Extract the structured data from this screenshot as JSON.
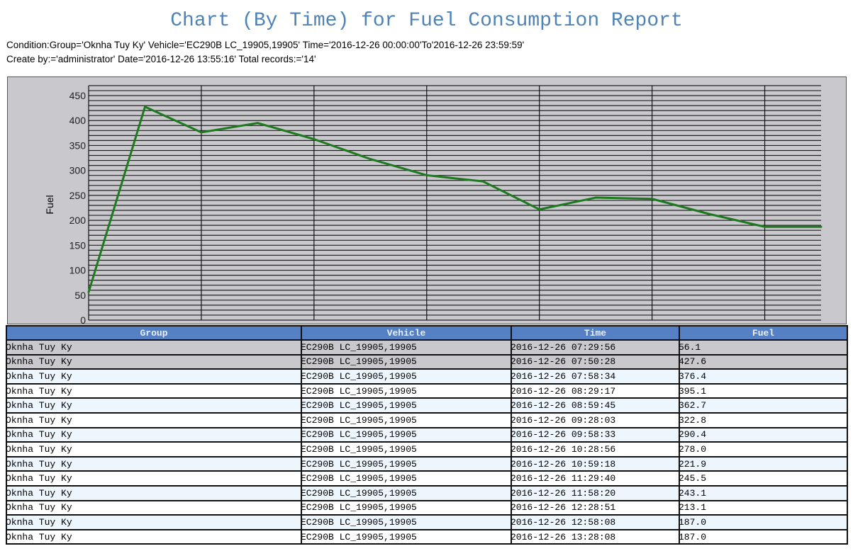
{
  "title": "Chart (By Time) for Fuel Consumption Report",
  "condition_line": "Condition:Group='Oknha Tuy Ky' Vehicle='EC290B LC_19905,19905' Time='2016-12-26 00:00:00'To'2016-12-26 23:59:59'",
  "create_line": "Create by:='administrator' Date='2016-12-26 13:55:16' Total records:='14'",
  "chart_data": {
    "type": "line",
    "ylabel": "Fuel",
    "xlabel": "",
    "ylim": [
      0,
      470
    ],
    "yticks": [
      0,
      50,
      100,
      150,
      200,
      250,
      300,
      350,
      400,
      450
    ],
    "grid": true,
    "line_color": "#1e7a1e",
    "x": [
      "2016-12-26 07:29:56",
      "2016-12-26 07:50:28",
      "2016-12-26 07:58:34",
      "2016-12-26 08:29:17",
      "2016-12-26 08:59:45",
      "2016-12-26 09:28:03",
      "2016-12-26 09:58:33",
      "2016-12-26 10:28:56",
      "2016-12-26 10:59:18",
      "2016-12-26 11:29:40",
      "2016-12-26 11:58:20",
      "2016-12-26 12:28:51",
      "2016-12-26 12:58:08",
      "2016-12-26 13:28:08"
    ],
    "values": [
      56.1,
      427.6,
      376.4,
      395.1,
      362.7,
      322.8,
      290.4,
      278.0,
      221.9,
      245.5,
      243.1,
      213.1,
      187.0,
      187.0
    ]
  },
  "table": {
    "headers": [
      "Group",
      "Vehicle",
      "Time",
      "Fuel"
    ],
    "rows": [
      [
        "Oknha Tuy Ky",
        "EC290B LC_19905,19905",
        "2016-12-26 07:29:56",
        "56.1"
      ],
      [
        "Oknha Tuy Ky",
        "EC290B LC_19905,19905",
        "2016-12-26 07:50:28",
        "427.6"
      ],
      [
        "Oknha Tuy Ky",
        "EC290B LC_19905,19905",
        "2016-12-26 07:58:34",
        "376.4"
      ],
      [
        "Oknha Tuy Ky",
        "EC290B LC_19905,19905",
        "2016-12-26 08:29:17",
        "395.1"
      ],
      [
        "Oknha Tuy Ky",
        "EC290B LC_19905,19905",
        "2016-12-26 08:59:45",
        "362.7"
      ],
      [
        "Oknha Tuy Ky",
        "EC290B LC_19905,19905",
        "2016-12-26 09:28:03",
        "322.8"
      ],
      [
        "Oknha Tuy Ky",
        "EC290B LC_19905,19905",
        "2016-12-26 09:58:33",
        "290.4"
      ],
      [
        "Oknha Tuy Ky",
        "EC290B LC_19905,19905",
        "2016-12-26 10:28:56",
        "278.0"
      ],
      [
        "Oknha Tuy Ky",
        "EC290B LC_19905,19905",
        "2016-12-26 10:59:18",
        "221.9"
      ],
      [
        "Oknha Tuy Ky",
        "EC290B LC_19905,19905",
        "2016-12-26 11:29:40",
        "245.5"
      ],
      [
        "Oknha Tuy Ky",
        "EC290B LC_19905,19905",
        "2016-12-26 11:58:20",
        "243.1"
      ],
      [
        "Oknha Tuy Ky",
        "EC290B LC_19905,19905",
        "2016-12-26 12:28:51",
        "213.1"
      ],
      [
        "Oknha Tuy Ky",
        "EC290B LC_19905,19905",
        "2016-12-26 12:58:08",
        "187.0"
      ],
      [
        "Oknha Tuy Ky",
        "EC290B LC_19905,19905",
        "2016-12-26 13:28:08",
        "187.0"
      ]
    ]
  }
}
